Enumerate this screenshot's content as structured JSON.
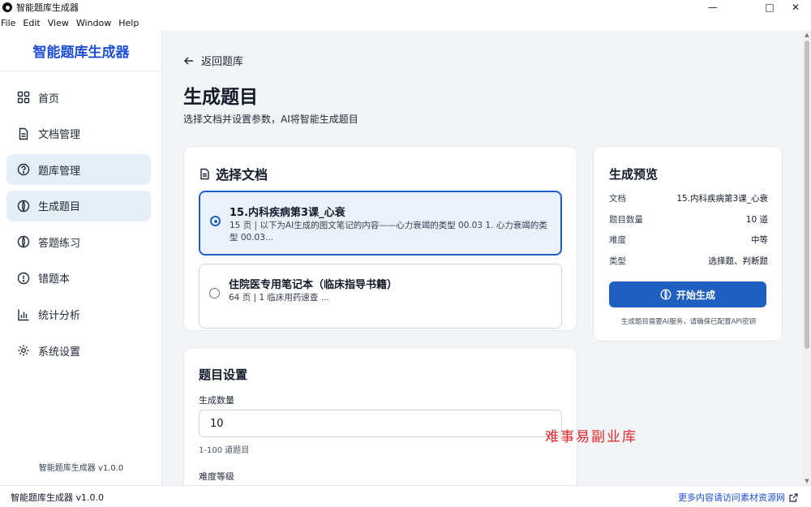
{
  "window": {
    "title": "智能题库生成器",
    "minimize": "—",
    "maximize": "□",
    "close": "✕"
  },
  "menu": [
    "File",
    "Edit",
    "View",
    "Window",
    "Help"
  ],
  "sidebar": {
    "brand": "智能题库生成器",
    "items": [
      {
        "label": "首页",
        "icon": "grid-icon"
      },
      {
        "label": "文档管理",
        "icon": "document-icon"
      },
      {
        "label": "题库管理",
        "icon": "question-circle-icon"
      },
      {
        "label": "生成题目",
        "icon": "spark-circle-icon"
      },
      {
        "label": "答题练习",
        "icon": "spark-circle-icon"
      },
      {
        "label": "错题本",
        "icon": "alert-circle-icon"
      },
      {
        "label": "统计分析",
        "icon": "bar-chart-icon"
      },
      {
        "label": "系统设置",
        "icon": "gear-icon"
      }
    ],
    "version": "智能题库生成器 v1.0.0"
  },
  "main": {
    "back_label": "返回题库",
    "title": "生成题目",
    "subtitle": "选择文档并设置参数，AI将智能生成题目",
    "doc_card": {
      "title": "选择文档",
      "documents": [
        {
          "name": "15.内科疾病第3课_心衰",
          "desc": "15 页 | 以下为AI生成的图文笔记的内容——心力衰竭的类型 00.03 1. 心力衰竭的类型 00.03...",
          "selected": true
        },
        {
          "name": "住院医专用笔记本（临床指导书籍）",
          "desc": "64 页 | 1 临床用药速查 ...",
          "selected": false
        }
      ]
    },
    "settings_card": {
      "title": "题目设置",
      "count_label": "生成数量",
      "count_value": "10",
      "count_hint": "1-100 道题目",
      "difficulty_label": "难度等级"
    },
    "preview_card": {
      "title": "生成预览",
      "rows": [
        {
          "key": "文档",
          "value": "15.内科疾病第3课_心衰"
        },
        {
          "key": "题目数量",
          "value": "10 道"
        },
        {
          "key": "难度",
          "value": "中等"
        },
        {
          "key": "类型",
          "value": "选择题、判断题"
        }
      ],
      "button": "开始生成",
      "note": "生成题目需要AI服务，请确保已配置API密钥"
    }
  },
  "watermark": "难事易副业库",
  "statusbar": {
    "left": "智能题库生成器 v1.0.0",
    "right": "更多内容请访问素材资源网"
  },
  "colors": {
    "accent": "#1e5fbf",
    "brand": "#1d4ed8",
    "active_nav": "#e6eef8",
    "selected_bg": "#eaf1fb",
    "watermark": "#e0262d"
  }
}
